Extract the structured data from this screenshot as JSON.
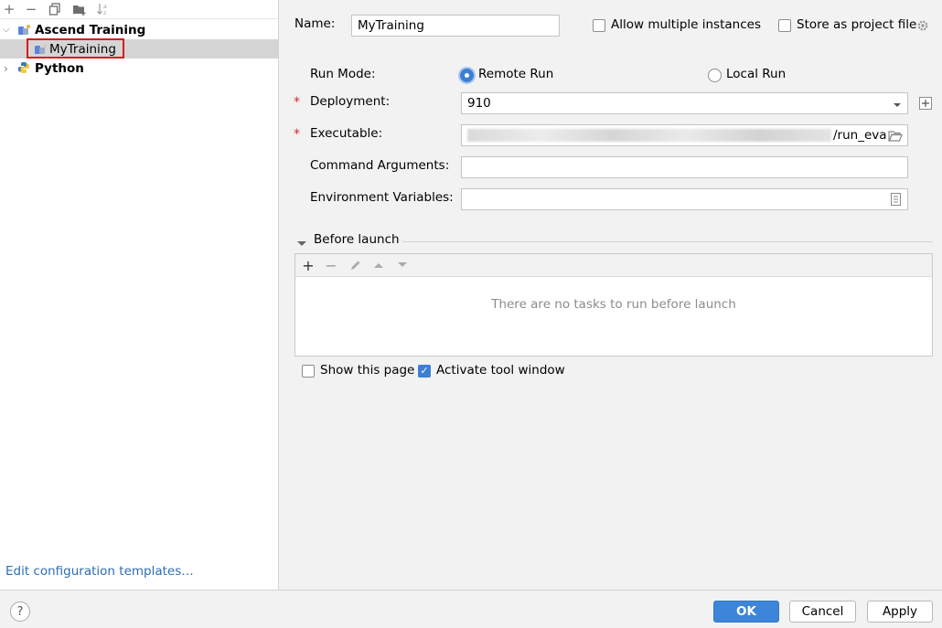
{
  "toolbar": {
    "icons": [
      "add-icon",
      "remove-icon",
      "copy-icon",
      "new-folder-icon",
      "sort-icon"
    ],
    "add": "+",
    "remove": "−"
  },
  "tree": {
    "groups": [
      {
        "label": "Ascend Training",
        "expanded": true,
        "children": [
          {
            "label": "MyTraining",
            "selected": true
          }
        ]
      },
      {
        "label": "Python",
        "expanded": false,
        "children": []
      }
    ]
  },
  "edit_templates_link": "Edit configuration templates…",
  "form": {
    "name_label": "Name:",
    "name_value": "MyTraining",
    "allow_multiple_label": "Allow multiple instances",
    "allow_multiple_checked": false,
    "store_project_label": "Store as project file",
    "store_project_checked": false,
    "run_mode_label": "Run Mode:",
    "remote_run_label": "Remote Run",
    "local_run_label": "Local Run",
    "selected_run_mode": "Remote Run",
    "required_marker": "*",
    "deployment_label": "Deployment:",
    "deployment_value": "910",
    "executable_label": "Executable:",
    "executable_value_visible": "/run_eva",
    "command_args_label": "Command Arguments:",
    "command_args_value": "",
    "env_vars_label": "Environment Variables:",
    "env_vars_value": ""
  },
  "before_launch": {
    "title": "Before launch",
    "toolbar_icons": [
      "add-icon",
      "remove-icon",
      "edit-icon",
      "move-up-icon",
      "move-down-icon"
    ],
    "empty_text": "There are no tasks to run before launch"
  },
  "show_this_page_label": "Show this page",
  "show_this_page_checked": false,
  "activate_tool_window_label": "Activate tool window",
  "activate_tool_window_checked": true,
  "buttons": {
    "help": "?",
    "ok": "OK",
    "cancel": "Cancel",
    "apply": "Apply"
  },
  "colors": {
    "accent": "#3d85d8",
    "highlight_box": "#e0161c",
    "link": "#2d6db5",
    "required": "#d9262c"
  }
}
